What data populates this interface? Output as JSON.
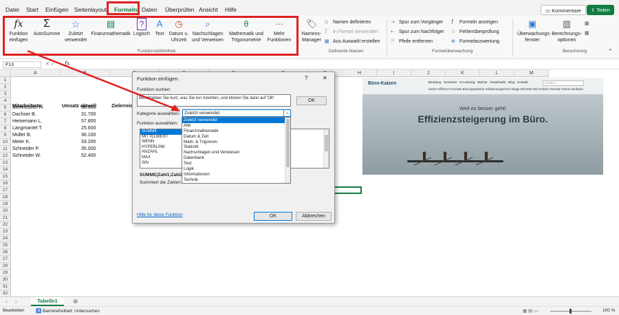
{
  "menu": [
    "Datei",
    "Start",
    "Einfügen",
    "Seitenlayout",
    "Formeln",
    "Daten",
    "Überprüfen",
    "Ansicht",
    "Hilfe"
  ],
  "top_buttons": {
    "comments": "Kommentare",
    "share": "Teilen"
  },
  "ribbon": {
    "insert_function": {
      "icon": "fx",
      "label": "Funktion einfügen"
    },
    "autosum": "AutoSumme",
    "recent": "Zuletzt verwendet",
    "financial": "Finanzmathematik",
    "logical": "Logisch",
    "text": "Text",
    "datetime": "Datum u. Uhrzeit",
    "lookup": "Nachschlagen und Verweisen",
    "math": "Mathematik und Trigonometrie",
    "more": "Mehr Funktionen",
    "group_library": "Funktionsbibliothek",
    "name_manager": "Namens-Manager",
    "define_name": "Namen definieren",
    "use_in_formula": "In Formel verwenden",
    "create_from_sel": "Aus Auswahl erstellen",
    "group_names": "Definierte Namen",
    "trace_precedents": "Spur zum Vorgänger",
    "trace_dependents": "Spur zum Nachfolger",
    "remove_arrows": "Pfeile entfernen",
    "show_formulas": "Formeln anzeigen",
    "error_checking": "Fehlerüberprüfung",
    "evaluate": "Formelauswertung",
    "group_audit": "Formelüberwachung",
    "watch": "Überwachungs-fenster",
    "calc_options": "Berechnungs-optionen",
    "group_calc": "Berechnung"
  },
  "formula_bar": {
    "cell_ref": "F13",
    "fx": "fx"
  },
  "columns": [
    "A",
    "B",
    "C",
    "D",
    "E",
    "F",
    "G",
    "H",
    "I",
    "J",
    "K",
    "L",
    "M"
  ],
  "rows": [
    "1",
    "2",
    "3",
    "4",
    "5",
    "6",
    "7",
    "8",
    "9",
    "10",
    "11",
    "12",
    "13",
    "14",
    "15",
    "16",
    "17",
    "18",
    "19",
    "20",
    "21",
    "22",
    "23",
    "24",
    "25",
    "26",
    "27",
    "28",
    "29",
    "30",
    "31",
    "32"
  ],
  "sheet": {
    "header_a": "MitarbeiterIn:",
    "header_b": "Umsatz aktuell:",
    "header_c": "Zielerreic",
    "employees": [
      {
        "name": "Bernreuther H.",
        "value": "38.500"
      },
      {
        "name": "Dachser B.",
        "value": "31.700"
      },
      {
        "name": "Heinemann L.",
        "value": "57.800"
      },
      {
        "name": "Langmantel T.",
        "value": "25.600"
      },
      {
        "name": "Müller B.",
        "value": "36.100"
      },
      {
        "name": "Meier K.",
        "value": "33.200"
      },
      {
        "name": "Schneider P.",
        "value": "35.000"
      },
      {
        "name": "Schneider W.",
        "value": "52.400"
      }
    ]
  },
  "dialog": {
    "title": "Funktion einfügen",
    "help": "?",
    "close": "✕",
    "search_label": "Funktion suchen:",
    "search_placeholder": "Beschreiben Sie kurz, was Sie tun möchten, und klicken Sie dann auf 'OK'",
    "search_ok": "OK",
    "category_label": "Kategorie auswählen:",
    "category_value": "Zuletzt verwendet",
    "function_label": "Funktion auswählen:",
    "functions": [
      "SUMME",
      "MITTELWERT",
      "WENN",
      "HYPERLINK",
      "ANZAHL",
      "MAX",
      "SIN"
    ],
    "signature": "SUMME(Zahl1;Zahl2;",
    "description": "Summiert die Zahlen in",
    "help_link": "Hilfe für diese Funktion",
    "ok": "OK",
    "cancel": "Abbrechen",
    "categories": [
      "Zuletzt verwendet",
      "Alle",
      "Finanzmathematik",
      "Datum & Zeit",
      "Math. & Trigonom.",
      "Statistik",
      "Nachschlagen und Verweisen",
      "Datenbank",
      "Text",
      "Logik",
      "Informationen",
      "Technik"
    ]
  },
  "ad": {
    "brand": "Büro-Kaizen",
    "search_placeholder": "Suchen...",
    "nav1": [
      "Beratung",
      "Seminare",
      "E-Learning",
      "Bücher",
      "Downloads",
      "Blog",
      "Kontakt"
    ],
    "nav2": [
      "Kaizen",
      "Effizienz",
      "Prozesse",
      "Büroorganisation",
      "Selbstmanagement",
      "Ablage",
      "Microsoft 365",
      "Outlook",
      "OneNote",
      "Teams",
      "Hardware"
    ],
    "tagline": "Weil es besser geht!",
    "headline": "Effizienzsteigerung im Büro."
  },
  "sheet_tab": "Tabelle1",
  "status": {
    "ready": "Bearbeiten",
    "accessibility": "Barrierefreiheit: Untersuchen",
    "zoom": "100 %"
  },
  "colors": {
    "excel_green": "#107c41",
    "highlight_red": "#e02020",
    "selection_blue": "#0078d7"
  }
}
